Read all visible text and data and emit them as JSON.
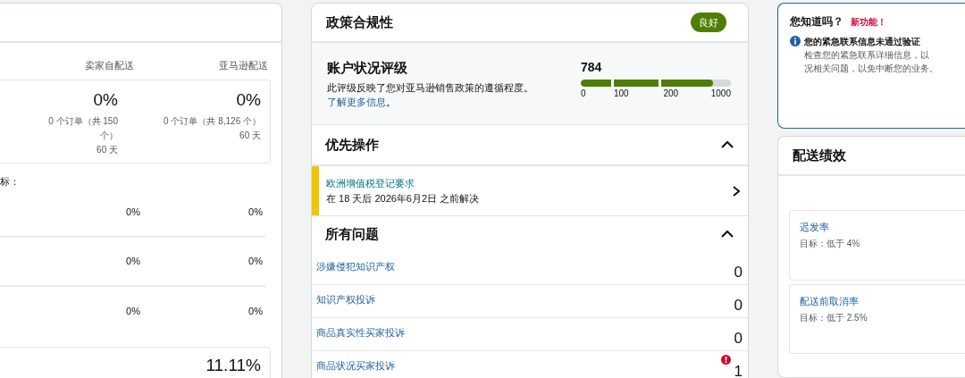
{
  "fulfillment_card": {
    "columns": [
      "卖家自配送",
      "亚马逊配送"
    ],
    "summary": [
      {
        "value": "0%",
        "orders": "0 个订单（共 150 个）",
        "period": "60 天"
      },
      {
        "value": "0%",
        "orders": "0 个订单（共 8,126 个）",
        "period": "60 天"
      }
    ],
    "targets_label": "标：",
    "rows": [
      [
        "0%",
        "0%"
      ],
      [
        "0%",
        "0%"
      ],
      [
        "0%",
        "0%"
      ]
    ],
    "bottom_value": "11.11%"
  },
  "policy_card": {
    "title": "政策合规性",
    "status": "良好",
    "rating": {
      "title": "账户状况评级",
      "description": "此评级反映了您对亚马逊销售政策的遵循程度。",
      "link": "了解更多信息",
      "link_suffix": "。",
      "score": "784",
      "level": 0.88,
      "ticks": [
        "0",
        "100",
        "200",
        "1000"
      ]
    },
    "priority": {
      "title": "优先操作",
      "expanded": true,
      "items": [
        {
          "title": "欧洲增值税登记要求",
          "detail": "在 18 天后 2026年6月2日 之前解决",
          "color": "#f5c400"
        }
      ]
    },
    "issues": {
      "title": "所有问题",
      "expanded": true,
      "items": [
        {
          "label": "涉嫌侵犯知识产权",
          "count": "0",
          "alert": false
        },
        {
          "label": "知识产权投诉",
          "count": "0",
          "alert": false
        },
        {
          "label": "商品真实性买家投诉",
          "count": "0",
          "alert": false
        },
        {
          "label": "商品状况买家投诉",
          "count": "1",
          "alert": true
        }
      ]
    }
  },
  "notice_card": {
    "title": "您知道吗？",
    "badge": "新功能！",
    "heading": "您的紧急联系信息未通过验证",
    "lines": [
      "检查您的紧急联系详细信息，以",
      "况相关问题，以免中断您的业务。"
    ]
  },
  "shipping_card": {
    "title": "配送绩效",
    "metrics": [
      {
        "name": "迟发率",
        "target": "目标：低于 4%"
      },
      {
        "name": "配送前取消率",
        "target": "目标：低于 2.5%"
      }
    ]
  }
}
